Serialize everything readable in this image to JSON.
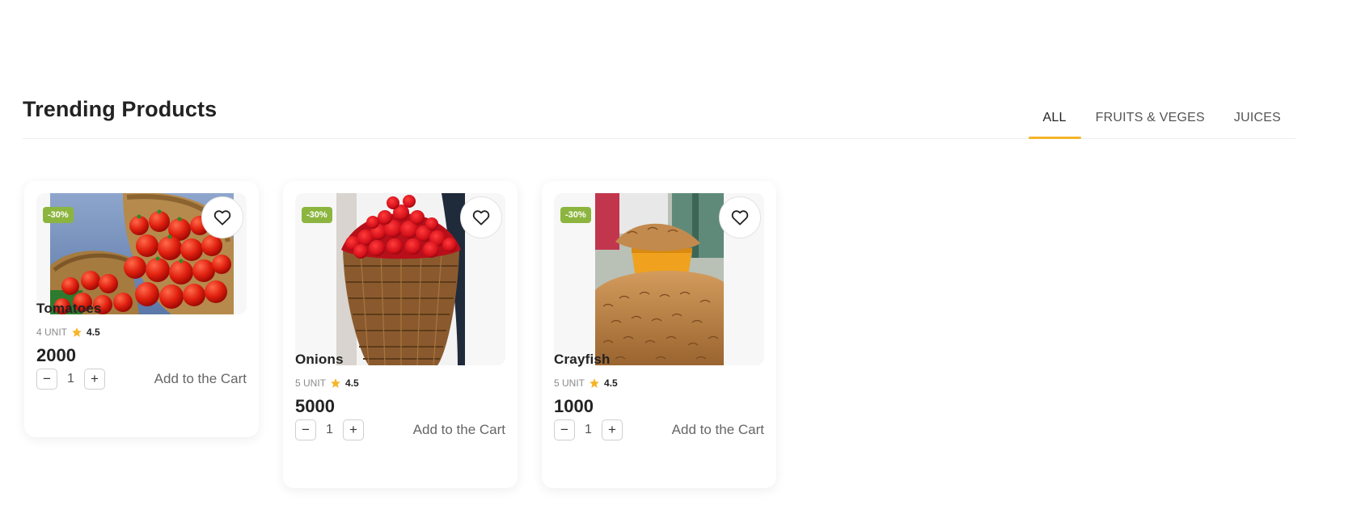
{
  "section": {
    "title": "Trending Products"
  },
  "tabs": [
    {
      "label": "ALL",
      "active": true
    },
    {
      "label": "FRUITS & VEGES",
      "active": false
    },
    {
      "label": "JUICES",
      "active": false
    }
  ],
  "products": [
    {
      "name": "Tomatoes",
      "badge": "-30%",
      "unit": "4 UNIT",
      "rating": "4.5",
      "price": "2000",
      "qty": "1",
      "cart_label": "Add to the Cart",
      "favorite_icon": "heart-icon",
      "rating_icon": "star-icon"
    },
    {
      "name": "Onions",
      "badge": "-30%",
      "unit": "5 UNIT",
      "rating": "4.5",
      "price": "5000",
      "qty": "1",
      "cart_label": "Add to the Cart",
      "favorite_icon": "heart-icon",
      "rating_icon": "star-icon"
    },
    {
      "name": "Crayfish",
      "badge": "-30%",
      "unit": "5 UNIT",
      "rating": "4.5",
      "price": "1000",
      "qty": "1",
      "cart_label": "Add to the Cart",
      "favorite_icon": "heart-icon",
      "rating_icon": "star-icon"
    }
  ],
  "colors": {
    "accent": "#f5b528",
    "badge": "#8cb53f",
    "star": "#f5b528",
    "text": "#222222"
  }
}
